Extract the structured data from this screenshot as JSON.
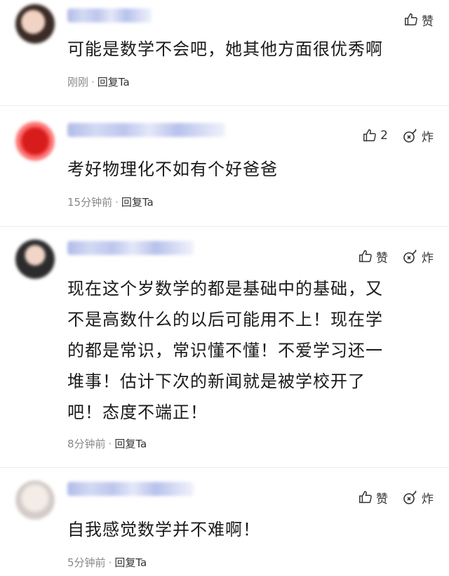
{
  "comments": [
    {
      "likes": "赞",
      "text": "可能是数学不会吧，她其他方面很优秀啊",
      "time": "刚刚",
      "reply": "回复Ta"
    },
    {
      "likes": "2",
      "bomb": "炸",
      "text": "考好物理化不如有个好爸爸",
      "time": "15分钟前",
      "reply": "回复Ta"
    },
    {
      "likes": "赞",
      "bomb": "炸",
      "text": "现在这个岁数学的都是基础中的基础，又\n不是高数什么的以后可能用不上！现在学\n的都是常识，常识懂不懂！不爱学习还一\n堆事！估计下次的新闻就是被学校开了\n吧！态度不端正！",
      "time": "8分钟前",
      "reply": "回复Ta"
    },
    {
      "likes": "赞",
      "bomb": "炸",
      "text": "自我感觉数学并不难啊！",
      "time": "5分钟前",
      "reply": "回复Ta"
    }
  ],
  "icons": {
    "like": "thumbs-up-icon",
    "bomb": "bomb-icon"
  }
}
